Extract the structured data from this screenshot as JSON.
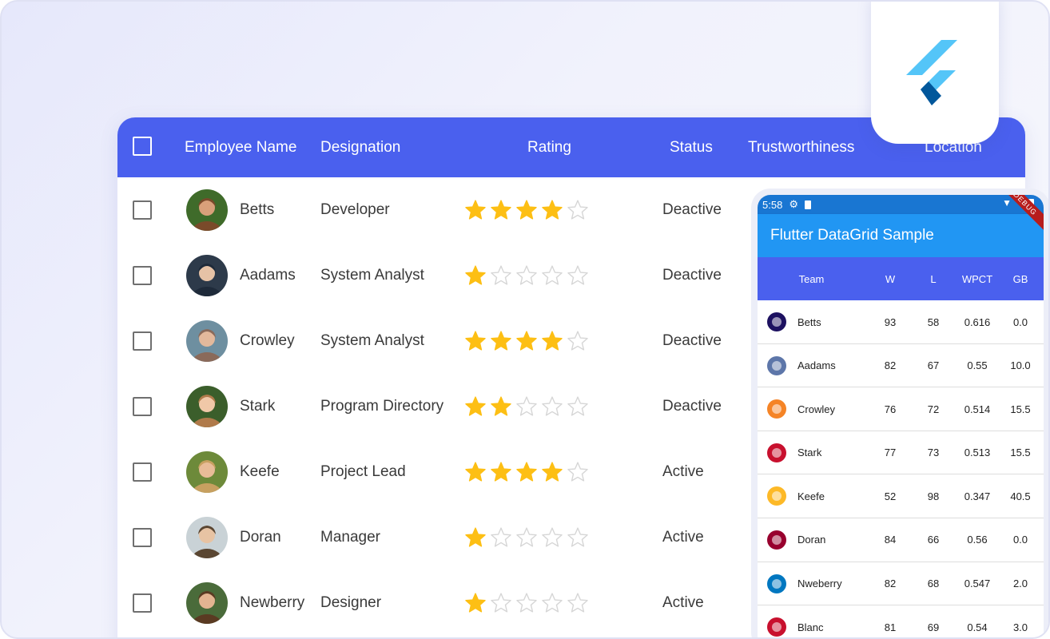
{
  "grid": {
    "columns": {
      "employee_name": "Employee Name",
      "designation": "Designation",
      "rating": "Rating",
      "status": "Status",
      "trustworthiness": "Trustworthiness",
      "location": "Location"
    },
    "rows": [
      {
        "name": "Betts",
        "designation": "Developer",
        "rating": 4,
        "status": "Deactive"
      },
      {
        "name": "Aadams",
        "designation": "System Analyst",
        "rating": 1,
        "status": "Deactive"
      },
      {
        "name": "Crowley",
        "designation": "System Analyst",
        "rating": 4,
        "status": "Deactive"
      },
      {
        "name": "Stark",
        "designation": "Program Directory",
        "rating": 2,
        "status": "Deactive"
      },
      {
        "name": "Keefe",
        "designation": "Project Lead",
        "rating": 4,
        "status": "Active"
      },
      {
        "name": "Doran",
        "designation": "Manager",
        "rating": 1,
        "status": "Active"
      },
      {
        "name": "Newberry",
        "designation": "Designer",
        "rating": 1,
        "status": "Active"
      }
    ],
    "rating_max": 5,
    "colors": {
      "header": "#4a60ee",
      "star": "#fdbf14",
      "deactive": "#f0494a",
      "active": "#4bb543"
    }
  },
  "phone": {
    "time": "5:58",
    "app_title": "Flutter DataGrid Sample",
    "debug_label": "DEBUG",
    "columns": {
      "team": "Team",
      "w": "W",
      "l": "L",
      "wpct": "WPCT",
      "gb": "GB"
    },
    "rows": [
      {
        "team": "Betts",
        "w": "93",
        "l": "58",
        "wpct": "0.616",
        "gb": "0.0",
        "logo": "hornets-logo-icon",
        "color": "#1d1160"
      },
      {
        "team": "Aadams",
        "w": "82",
        "l": "67",
        "wpct": "0.55",
        "gb": "10.0",
        "logo": "grizzlies-logo-icon",
        "color": "#5d76a9"
      },
      {
        "team": "Crowley",
        "w": "76",
        "l": "72",
        "wpct": "0.514",
        "gb": "15.5",
        "logo": "knicks-logo-icon",
        "color": "#f58426"
      },
      {
        "team": "Stark",
        "w": "77",
        "l": "73",
        "wpct": "0.513",
        "gb": "15.5",
        "logo": "pistons-logo-icon",
        "color": "#c8102e"
      },
      {
        "team": "Keefe",
        "w": "52",
        "l": "98",
        "wpct": "0.347",
        "gb": "40.5",
        "logo": "lakers-logo-icon",
        "color": "#fdb927"
      },
      {
        "team": "Doran",
        "w": "84",
        "l": "66",
        "wpct": "0.56",
        "gb": "0.0",
        "logo": "heat-logo-icon",
        "color": "#98002e"
      },
      {
        "team": "Nweberry",
        "w": "82",
        "l": "68",
        "wpct": "0.547",
        "gb": "2.0",
        "logo": "magic-logo-icon",
        "color": "#0077c0"
      },
      {
        "team": "Blanc",
        "w": "81",
        "l": "69",
        "wpct": "0.54",
        "gb": "3.0",
        "logo": "clippers-logo-icon",
        "color": "#c8102e"
      }
    ]
  }
}
